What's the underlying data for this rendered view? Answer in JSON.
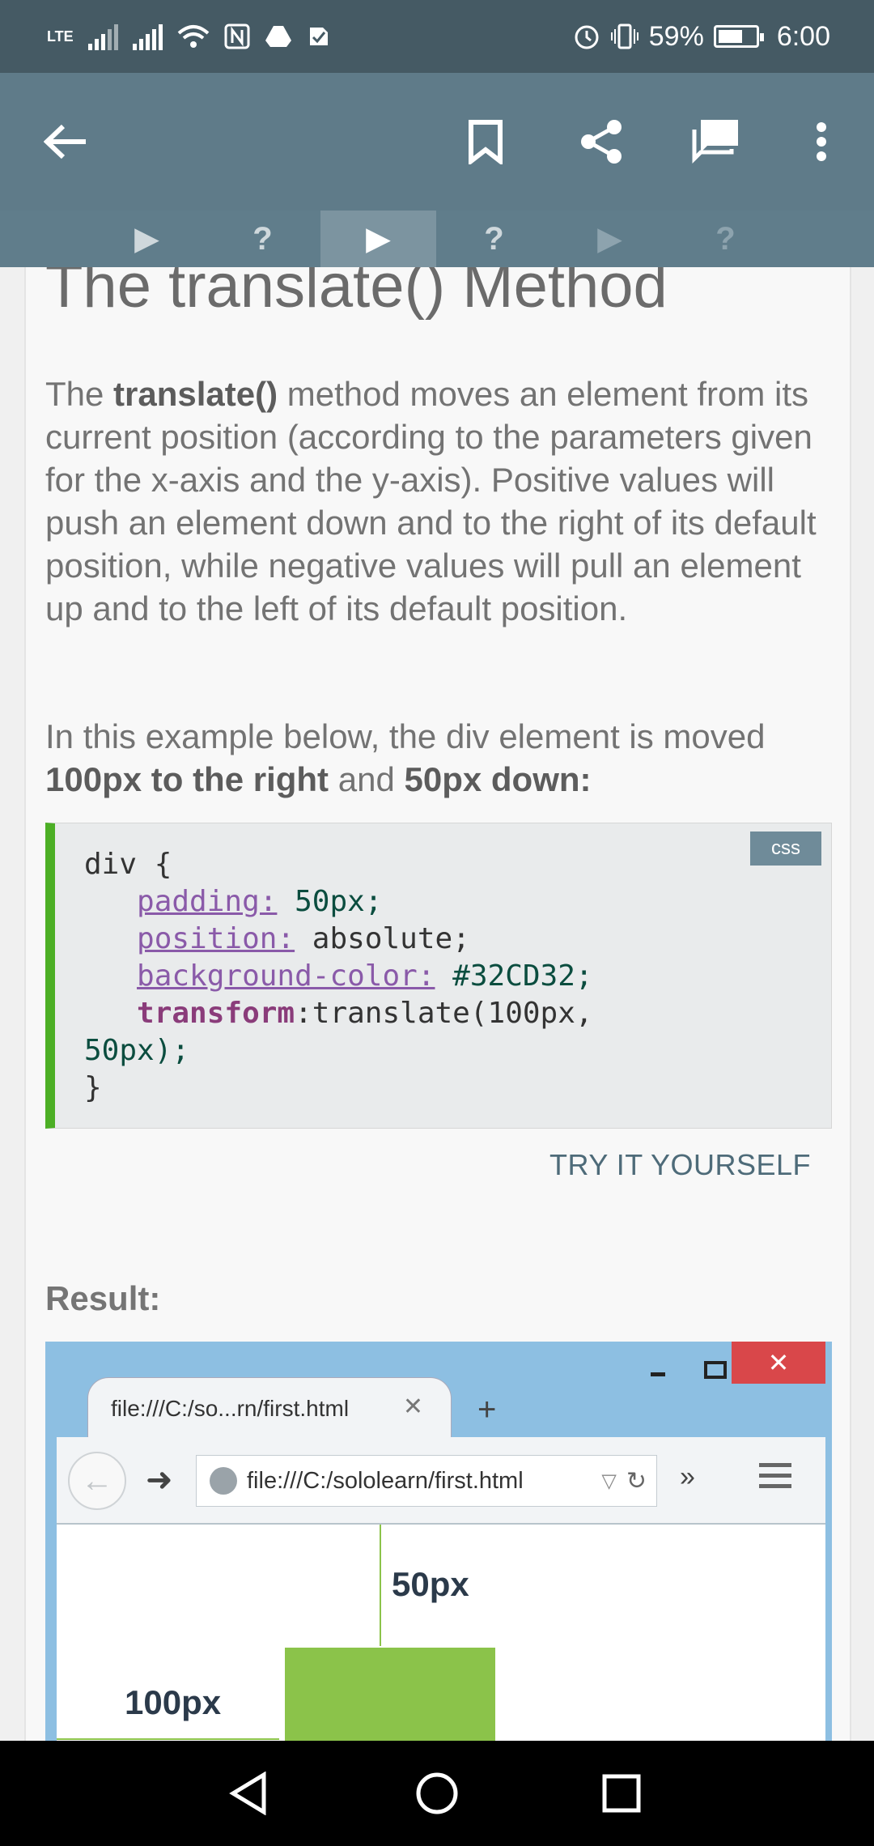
{
  "status_bar": {
    "network": "LTE",
    "battery_percent": "59%",
    "time": "6:00",
    "icons": [
      "signal-icon",
      "wifi-icon",
      "nfc-icon",
      "drive-icon",
      "check-icon",
      "alarm-icon",
      "vibrate-icon",
      "battery-icon"
    ]
  },
  "app_bar": {
    "icons": [
      "back-arrow-icon",
      "bookmark-icon",
      "share-icon",
      "comments-icon",
      "more-vert-icon"
    ]
  },
  "lesson_tabs": [
    {
      "label": "▶",
      "state": "done"
    },
    {
      "label": "?",
      "state": "done"
    },
    {
      "label": "▶",
      "state": "active"
    },
    {
      "label": "?",
      "state": "normal"
    },
    {
      "label": "▶",
      "state": "dim"
    },
    {
      "label": "?",
      "state": "dim"
    }
  ],
  "content": {
    "title": "The translate() Method",
    "para1_pre": "The ",
    "para1_bold": "translate()",
    "para1_post": " method moves an element from its current position (according to the parameters given for the x-axis and the y-axis). Positive values will push an element down and to the right of its default position, while negative values will pull an element up and to the left of its default position.",
    "para2_pre": "In this example below, the div element is moved ",
    "para2_bold1": "100px to the right",
    "para2_mid": " and ",
    "para2_bold2": "50px down:",
    "code_lang": "css",
    "code": {
      "line1": "div {",
      "padding_prop": "padding:",
      "padding_val": " 50px;",
      "position_prop": "position:",
      "position_val": " absolute;",
      "bg_prop": "background-color:",
      "bg_val": " #32CD32;",
      "transform_prop": "transform",
      "transform_val": ":translate(100px,",
      "line_cont": "50px);",
      "line_close": "}"
    },
    "try_label": "TRY IT YOURSELF",
    "result_label": "Result:"
  },
  "result_image": {
    "tab_title": "file:///C:/so...rn/first.html",
    "url": "file:///C:/sololearn/first.html",
    "label_down": "50px",
    "label_right": "100px",
    "box_color": "#8BC34A"
  },
  "nav_bar": {
    "icons": [
      "back-triangle-icon",
      "home-circle-icon",
      "recents-square-icon"
    ]
  }
}
